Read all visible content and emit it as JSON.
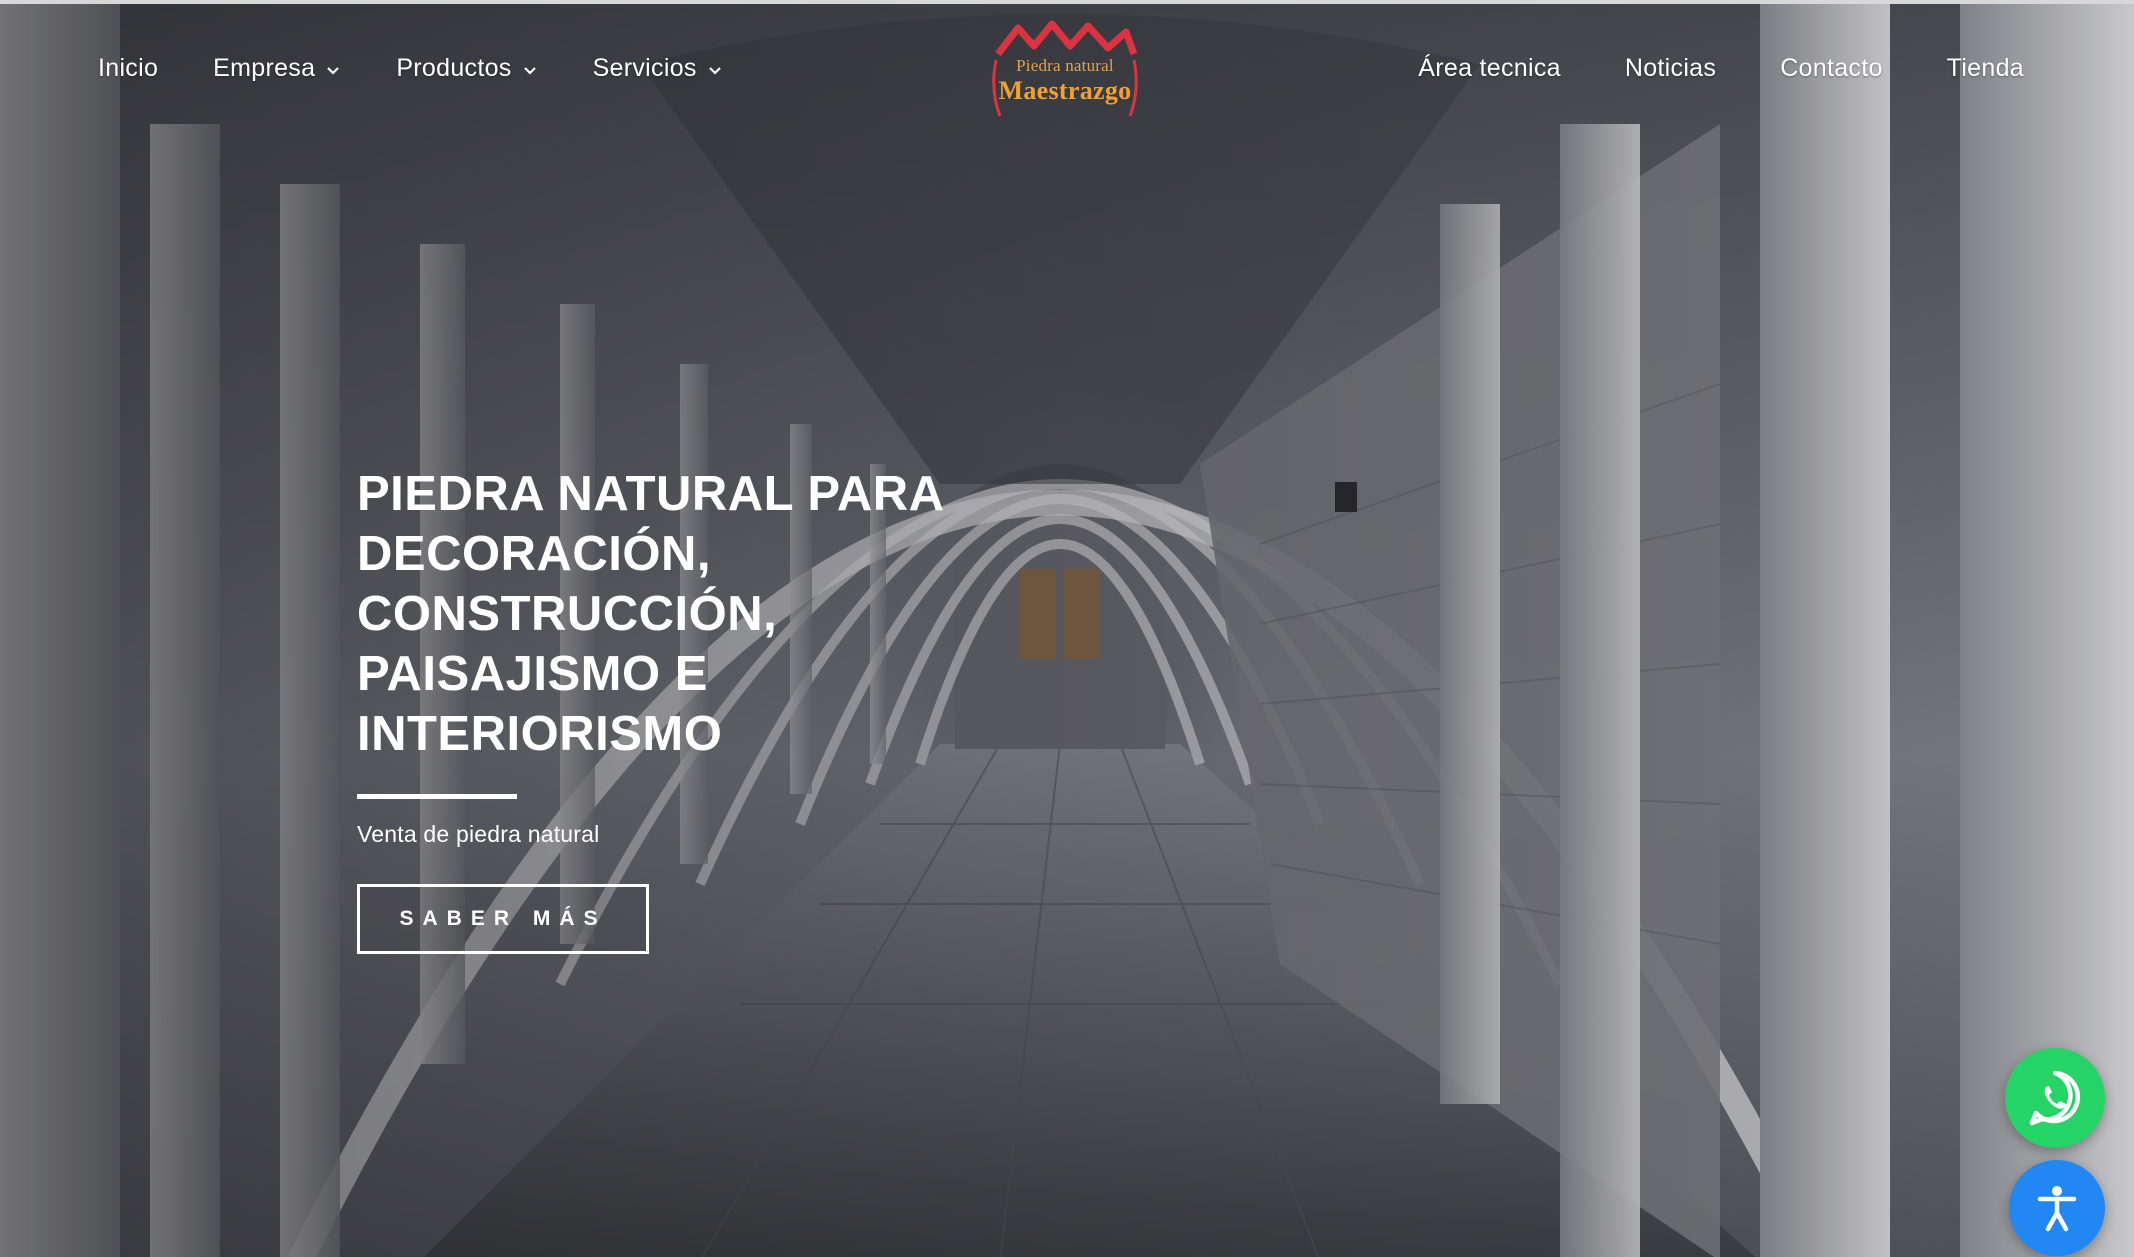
{
  "nav": {
    "left": [
      {
        "label": "Inicio",
        "dropdown": false
      },
      {
        "label": "Empresa",
        "dropdown": true
      },
      {
        "label": "Productos",
        "dropdown": true
      },
      {
        "label": "Servicios",
        "dropdown": true
      }
    ],
    "right": [
      {
        "label": "Área tecnica"
      },
      {
        "label": "Noticias"
      },
      {
        "label": "Contacto"
      },
      {
        "label": "Tienda"
      }
    ]
  },
  "logo": {
    "line1": "Piedra natural",
    "line2": "Maestrazgo",
    "accent_color": "#d9343f",
    "text_color": "#f0a034"
  },
  "hero": {
    "title_lines": [
      "PIEDRA NATURAL PARA",
      "DECORACIÓN,",
      "CONSTRUCCIÓN,",
      "PAISAJISMO E",
      "INTERIORISMO"
    ],
    "subtitle": "Venta de piedra natural",
    "cta_label": "SABER MÁS"
  },
  "floating": {
    "whatsapp_icon": "whatsapp-icon",
    "whatsapp_color": "#25d366",
    "accessibility_icon": "accessibility-icon",
    "accessibility_color": "#2187f2"
  }
}
